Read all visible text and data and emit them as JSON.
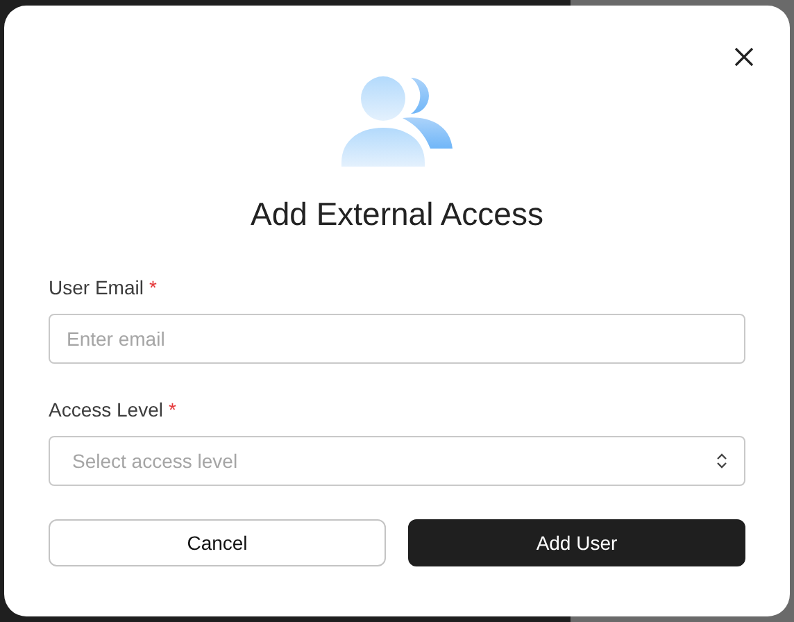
{
  "dialog": {
    "title": "Add External Access",
    "fields": [
      {
        "kind": "text",
        "label": "User Email",
        "required_mark": "*",
        "placeholder": "Enter email"
      },
      {
        "kind": "select",
        "label": "Access Level",
        "required_mark": "*",
        "placeholder": "Select access level"
      }
    ],
    "buttons": [
      {
        "label": "Cancel",
        "kind": "secondary"
      },
      {
        "label": "Add User",
        "kind": "primary"
      }
    ]
  }
}
